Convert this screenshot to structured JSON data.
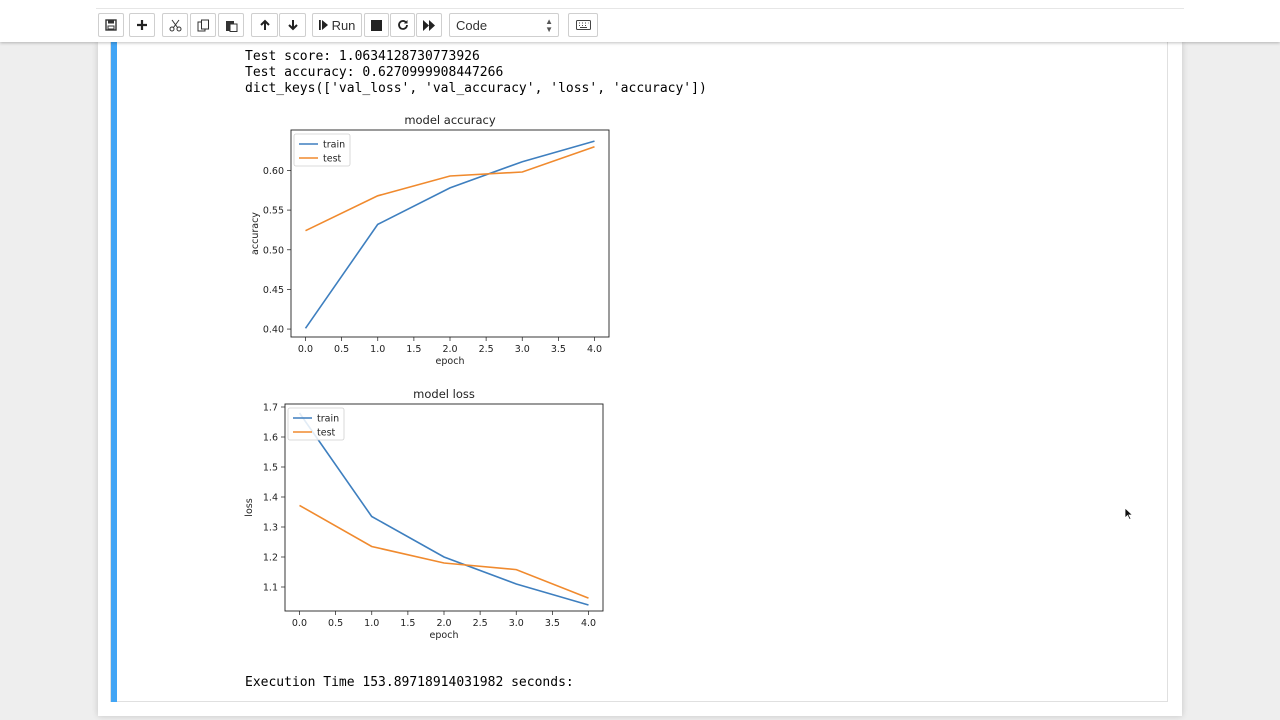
{
  "toolbar": {
    "run_label": "Run",
    "cell_type": "Code",
    "icons": [
      "save-icon",
      "plus-icon",
      "cut-icon",
      "copy-icon",
      "paste-icon",
      "arrow-up-icon",
      "arrow-down-icon",
      "run-icon",
      "stop-icon",
      "restart-icon",
      "fast-forward-icon",
      "keyboard-icon"
    ]
  },
  "output": {
    "line1": "Test score: 1.0634128730773926",
    "line2": "Test accuracy: 0.6270999908447266",
    "line3": "dict_keys(['val_loss', 'val_accuracy', 'loss', 'accuracy'])",
    "footer": "Execution Time 153.89718914031982 seconds:"
  },
  "colors": {
    "train": "#3e7fbf",
    "test": "#f08a2e",
    "cell_accent": "#42a5f5"
  },
  "chart_data": [
    {
      "type": "line",
      "title": "model accuracy",
      "xlabel": "epoch",
      "ylabel": "accuracy",
      "x": [
        0,
        1,
        2,
        3,
        4
      ],
      "xlim": [
        -0.2,
        4.2
      ],
      "ylim": [
        0.39,
        0.651
      ],
      "xticks": [
        "0.0",
        "0.5",
        "1.0",
        "1.5",
        "2.0",
        "2.5",
        "3.0",
        "3.5",
        "4.0"
      ],
      "yticks": [
        "0.40",
        "0.45",
        "0.50",
        "0.55",
        "0.60"
      ],
      "legend_position": "upper-left",
      "series": [
        {
          "name": "train",
          "values": [
            0.401,
            0.532,
            0.578,
            0.611,
            0.637
          ]
        },
        {
          "name": "test",
          "values": [
            0.524,
            0.568,
            0.593,
            0.598,
            0.63
          ]
        }
      ]
    },
    {
      "type": "line",
      "title": "model loss",
      "xlabel": "epoch",
      "ylabel": "loss",
      "x": [
        0,
        1,
        2,
        3,
        4
      ],
      "xlim": [
        -0.2,
        4.2
      ],
      "ylim": [
        1.02,
        1.71
      ],
      "xticks": [
        "0.0",
        "0.5",
        "1.0",
        "1.5",
        "2.0",
        "2.5",
        "3.0",
        "3.5",
        "4.0"
      ],
      "yticks": [
        "1.1",
        "1.2",
        "1.3",
        "1.4",
        "1.5",
        "1.6",
        "1.7"
      ],
      "legend_position": "upper-left",
      "series": [
        {
          "name": "train",
          "values": [
            1.68,
            1.335,
            1.2,
            1.11,
            1.04
          ]
        },
        {
          "name": "test",
          "values": [
            1.372,
            1.235,
            1.18,
            1.158,
            1.063
          ]
        }
      ]
    }
  ]
}
